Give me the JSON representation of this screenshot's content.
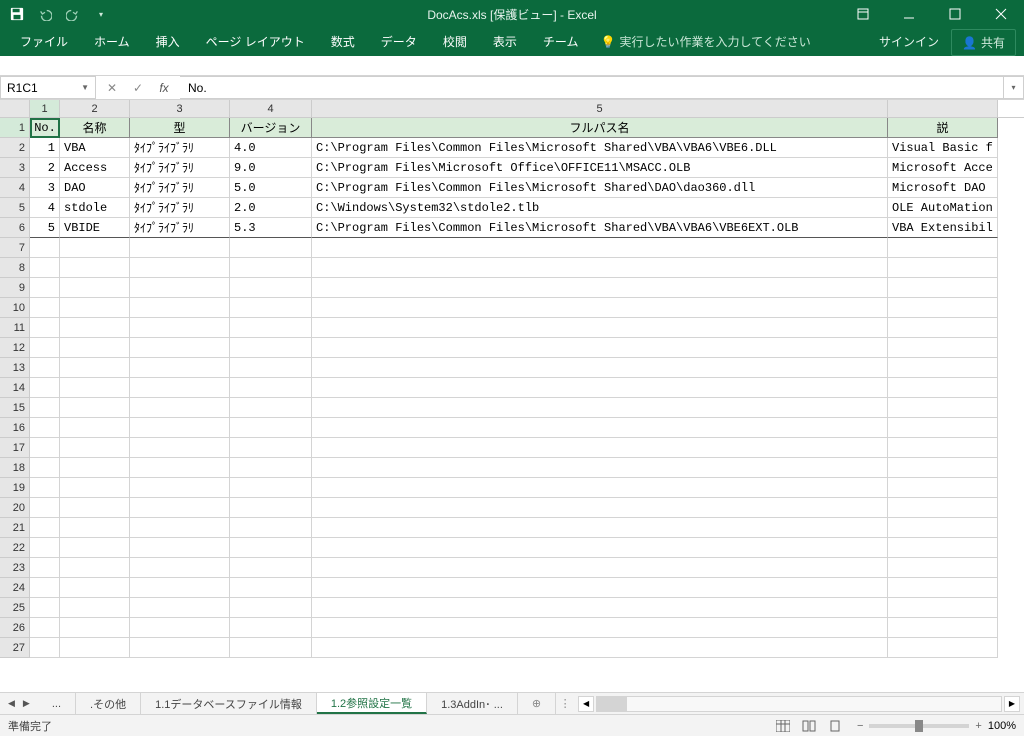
{
  "titlebar": {
    "title": "DocAcs.xls  [保護ビュー] - Excel"
  },
  "ribbon": {
    "tabs": [
      "ファイル",
      "ホーム",
      "挿入",
      "ページ レイアウト",
      "数式",
      "データ",
      "校閲",
      "表示",
      "チーム"
    ],
    "tellme": "実行したい作業を入力してください",
    "signin": "サインイン",
    "share": "共有"
  },
  "fbar": {
    "name": "R1C1",
    "value": "No."
  },
  "columns_hdr": [
    "1",
    "2",
    "3",
    "4",
    "5",
    ""
  ],
  "headers": [
    "No.",
    "名称",
    "型",
    "バージョン",
    "フルパス名",
    "説"
  ],
  "rows": [
    {
      "no": "1",
      "name": "VBA",
      "type": "ﾀｲﾌﾟﾗｲﾌﾞﾗﾘ",
      "ver": "4.0",
      "path": "C:\\Program Files\\Common Files\\Microsoft Shared\\VBA\\VBA6\\VBE6.DLL",
      "desc": "Visual Basic f"
    },
    {
      "no": "2",
      "name": "Access",
      "type": "ﾀｲﾌﾟﾗｲﾌﾞﾗﾘ",
      "ver": "9.0",
      "path": "C:\\Program Files\\Microsoft Office\\OFFICE11\\MSACC.OLB",
      "desc": "Microsoft Acce"
    },
    {
      "no": "3",
      "name": "DAO",
      "type": "ﾀｲﾌﾟﾗｲﾌﾞﾗﾘ",
      "ver": "5.0",
      "path": "C:\\Program Files\\Common Files\\Microsoft Shared\\DAO\\dao360.dll",
      "desc": "Microsoft DAO "
    },
    {
      "no": "4",
      "name": "stdole",
      "type": "ﾀｲﾌﾟﾗｲﾌﾞﾗﾘ",
      "ver": "2.0",
      "path": "C:\\Windows\\System32\\stdole2.tlb",
      "desc": "OLE AutoMation"
    },
    {
      "no": "5",
      "name": "VBIDE",
      "type": "ﾀｲﾌﾟﾗｲﾌﾞﾗﾘ",
      "ver": "5.3",
      "path": "C:\\Program Files\\Common Files\\Microsoft Shared\\VBA\\VBA6\\VBE6EXT.OLB",
      "desc": "VBA Extensibil"
    }
  ],
  "sheettabs": {
    "ellipsis": "...",
    "items": [
      ".その他",
      "1.1データベースファイル情報",
      "1.2参照設定一覧",
      "1.3AddIn･ ..."
    ],
    "active_index": 2
  },
  "status": {
    "ready": "準備完了",
    "zoom": "100%"
  }
}
